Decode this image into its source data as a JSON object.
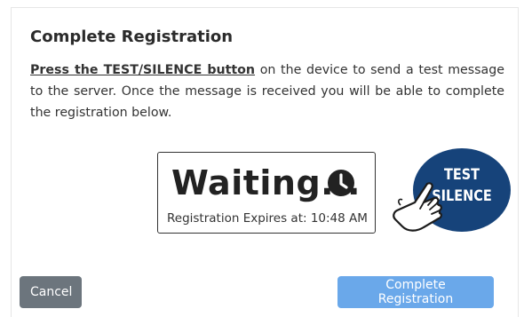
{
  "dialog": {
    "title": "Complete Registration",
    "instructions_strong": "Press the TEST/SILENCE button",
    "instructions_rest": " on the device to send a test message to the server. Once the message is received you will be able to complete the registration below."
  },
  "status": {
    "waiting_text": "Waiting...",
    "expires_label": "Registration Expires at: 10:48 AM",
    "icon": "clock-icon"
  },
  "device_button": {
    "line1": "TEST",
    "line2": "SILENCE",
    "badge_color": "#16437a",
    "icon": "pointing-hand-icon"
  },
  "actions": {
    "cancel_label": "Cancel",
    "complete_label": "Complete Registration",
    "cancel_color": "#6c757d",
    "complete_color": "#6aa8ea"
  }
}
